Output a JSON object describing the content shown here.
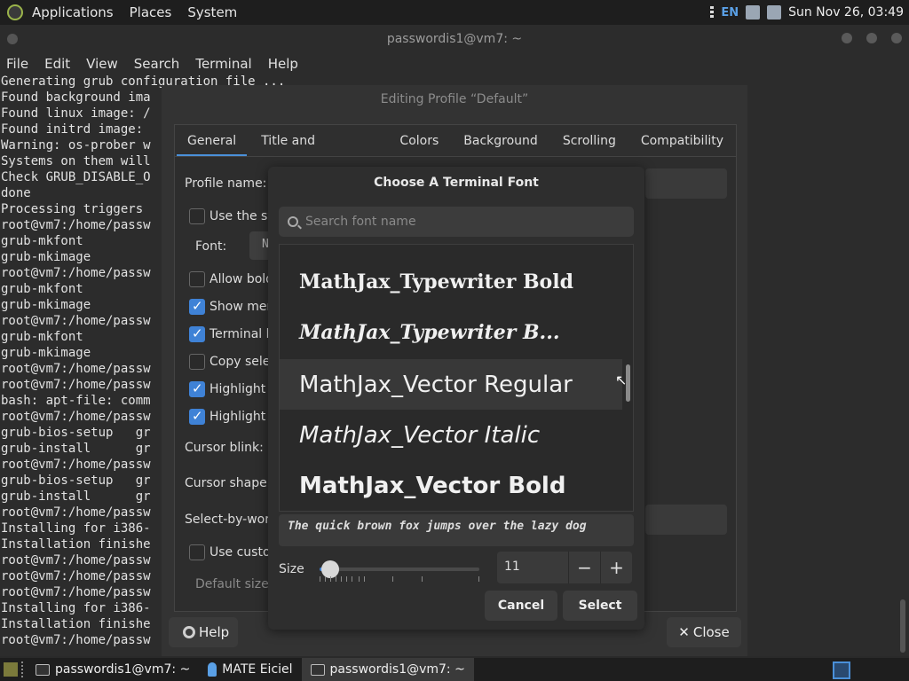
{
  "top_panel": {
    "menus": [
      "Applications",
      "Places",
      "System"
    ],
    "lang": "EN",
    "clock": "Sun Nov 26, 03:49"
  },
  "terminal": {
    "title": "passwordis1@vm7: ~",
    "menus": [
      "File",
      "Edit",
      "View",
      "Search",
      "Terminal",
      "Help"
    ],
    "lines": [
      "Generating grub configuration file ...",
      "Found background ima",
      "Found linux image: /",
      "Found initrd image: ",
      "Warning: os-prober w",
      "Systems on them will",
      "Check GRUB_DISABLE_O",
      "done",
      "Processing triggers ",
      "root@vm7:/home/passw",
      "grub-mkfont",
      "grub-mkimage",
      "root@vm7:/home/passw",
      "grub-mkfont",
      "grub-mkimage",
      "root@vm7:/home/passw",
      "grub-mkfont",
      "grub-mkimage",
      "root@vm7:/home/passw",
      "root@vm7:/home/passw",
      "bash: apt-file: comm",
      "root@vm7:/home/passw",
      "grub-bios-setup   gr",
      "grub-install      gr",
      "root@vm7:/home/passw",
      "grub-bios-setup   gr",
      "grub-install      gr",
      "root@vm7:/home/passw",
      "Installing for i386-",
      "Installation finishe",
      "root@vm7:/home/passw",
      "root@vm7:/home/passw",
      "root@vm7:/home/passw",
      "Installing for i386-",
      "Installation finishe",
      "root@vm7:/home/passw"
    ]
  },
  "profile_dialog": {
    "title": "Editing Profile “Default”",
    "tabs": [
      "General",
      "Title and Command",
      "Colors",
      "Background",
      "Scrolling",
      "Compatibility"
    ],
    "profile_name_label": "Profile name:",
    "use_system_font": "Use the sy",
    "font_label": "Font:",
    "font_value": "Nin",
    "allow_bold": "Allow bold",
    "show_menubar": "Show men",
    "terminal_bell": "Terminal b",
    "copy_selection": "Copy selec",
    "highlight_s": "Highlight S",
    "highlight_u": "Highlight U",
    "cursor_blink_label": "Cursor blink:",
    "cursor_shape_label": "Cursor shape:",
    "select_by_word_label": "Select-by-wor",
    "use_custom": "Use custor",
    "default_size_label": "Default size:",
    "help_button": "Help",
    "close_button": "Close"
  },
  "font_chooser": {
    "title": "Choose A Terminal Font",
    "search_placeholder": "Search font name",
    "fonts": [
      "MathJax_Typewriter Bold",
      "MathJax_Typewriter B...",
      "MathJax_Vector Regular",
      "MathJax_Vector Italic",
      "MathJax_Vector Bold"
    ],
    "selected_index": 2,
    "preview_text": "The quick brown fox jumps over the lazy dog",
    "size_label": "Size",
    "size_value": "11",
    "size_slider_fraction": 0.07,
    "cancel_button": "Cancel",
    "select_button": "Select"
  },
  "taskbar": {
    "items": [
      "passwordis1@vm7: ~",
      "MATE Eiciel",
      "passwordis1@vm7: ~"
    ],
    "active_index": 2
  },
  "colors": {
    "accent": "#3f82d6"
  }
}
